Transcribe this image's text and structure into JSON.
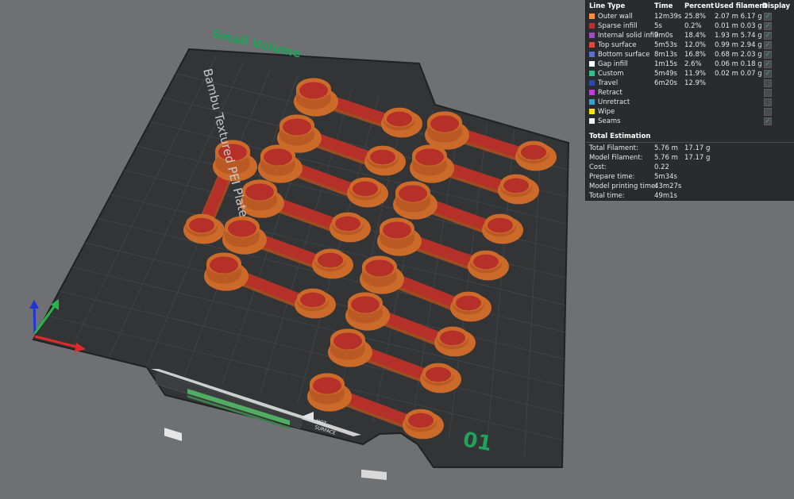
{
  "plate": {
    "volume_label": "Small Volume",
    "plate_name": "Bambu Textured PEI Plate",
    "plate_number": "01",
    "hot_surface": [
      "HOT",
      "SURFACE"
    ]
  },
  "colors": {
    "background": "#6f7074",
    "bed": "#333436",
    "bed_grid": "#43444a",
    "print_orange": "#cc6a2a",
    "print_red": "#b6302a",
    "label_green": "#1fa35a"
  },
  "legend": {
    "headers": {
      "line_type": "Line Type",
      "time": "Time",
      "percent": "Percent",
      "used": "Used filament",
      "display": "Display"
    },
    "rows": [
      {
        "name": "Outer wall",
        "color": "#ff8d35",
        "time": "12m39s",
        "percent": "25.8%",
        "used": "2.07 m  6.17 g",
        "checked": true
      },
      {
        "name": "Sparse infill",
        "color": "#b33232",
        "time": "5s",
        "percent": "0.2%",
        "used": "0.01 m  0.03 g",
        "checked": true
      },
      {
        "name": "Internal solid infill",
        "color": "#9a4ec1",
        "time": "9m0s",
        "percent": "18.4%",
        "used": "1.93 m  5.74 g",
        "checked": true
      },
      {
        "name": "Top surface",
        "color": "#e0473a",
        "time": "5m53s",
        "percent": "12.0%",
        "used": "0.99 m  2.94 g",
        "checked": true
      },
      {
        "name": "Bottom surface",
        "color": "#5c6fd1",
        "time": "8m13s",
        "percent": "16.8%",
        "used": "0.68 m  2.03 g",
        "checked": true
      },
      {
        "name": "Gap infill",
        "color": "#ffffff",
        "time": "1m15s",
        "percent": "2.6%",
        "used": "0.06 m  0.18 g",
        "checked": true
      },
      {
        "name": "Custom",
        "color": "#2fc08a",
        "time": "5m49s",
        "percent": "11.9%",
        "used": "0.02 m  0.07 g",
        "checked": true
      },
      {
        "name": "Travel",
        "color": "#2b4aa3",
        "time": "6m20s",
        "percent": "12.9%",
        "used": "",
        "checked": false
      },
      {
        "name": "Retract",
        "color": "#c13bd6",
        "time": "",
        "percent": "",
        "used": "",
        "checked": false
      },
      {
        "name": "Unretract",
        "color": "#3aa0c6",
        "time": "",
        "percent": "",
        "used": "",
        "checked": false
      },
      {
        "name": "Wipe",
        "color": "#f0e400",
        "time": "",
        "percent": "",
        "used": "",
        "checked": false
      },
      {
        "name": "Seams",
        "color": "#f2f2f2",
        "time": "",
        "percent": "",
        "used": "",
        "checked": true
      }
    ],
    "total_title": "Total Estimation",
    "totals": [
      {
        "label": "Total Filament:",
        "v1": "5.76 m",
        "v2": "17.17 g"
      },
      {
        "label": "Model Filament:",
        "v1": "5.76 m",
        "v2": "17.17 g"
      },
      {
        "label": "Cost:",
        "v1": "0.22",
        "v2": ""
      },
      {
        "label": "Prepare time:",
        "v1": "5m34s",
        "v2": ""
      },
      {
        "label": "Model printing time:",
        "v1": "43m27s",
        "v2": ""
      },
      {
        "label": "Total time:",
        "v1": "49m1s",
        "v2": ""
      }
    ]
  }
}
